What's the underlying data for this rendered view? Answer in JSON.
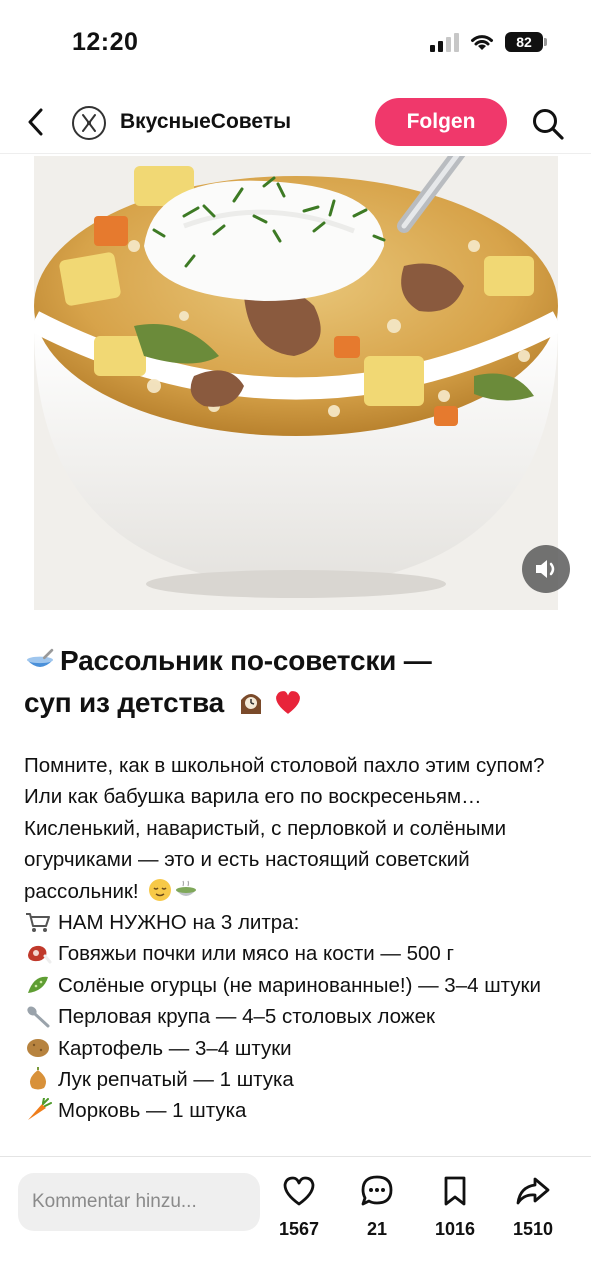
{
  "status_bar": {
    "time": "12:20",
    "battery": "82"
  },
  "header": {
    "channel_name": "ВкусныеСоветы",
    "follow_label": "Folgen"
  },
  "post": {
    "title_line1": "Рассольник по-советски —",
    "title_line2": "суп из детства",
    "intro": "Помните, как в школьной столовой пахло этим супом? Или как бабушка варила его по воскресеньям… Кисленький, наваристый, с перловкой и солёными огурчиками — это и есть настоящий советский рассольник!",
    "needs_label": "НАМ НУЖНО на 3 литра:",
    "ingredients": [
      {
        "icon": "meat-icon",
        "text": "Говяжьи почки или мясо на кости — 500 г"
      },
      {
        "icon": "cucumber-icon",
        "text": "Солёные огурцы (не маринованные!) — 3–4 штуки"
      },
      {
        "icon": "spoon-icon",
        "text": "Перловая крупа — 4–5 столовых ложек"
      },
      {
        "icon": "potato-icon",
        "text": "Картофель — 3–4 штуки"
      },
      {
        "icon": "onion-icon",
        "text": "Лук репчатый — 1 штука"
      },
      {
        "icon": "carrot-icon",
        "text": "Морковь — 1 штука"
      }
    ]
  },
  "bottom_bar": {
    "comment_placeholder": "Kommentar hinzu...",
    "likes": "1567",
    "comments": "21",
    "saves": "1016",
    "shares": "1510"
  },
  "colors": {
    "follow_button": "#f0386b"
  }
}
